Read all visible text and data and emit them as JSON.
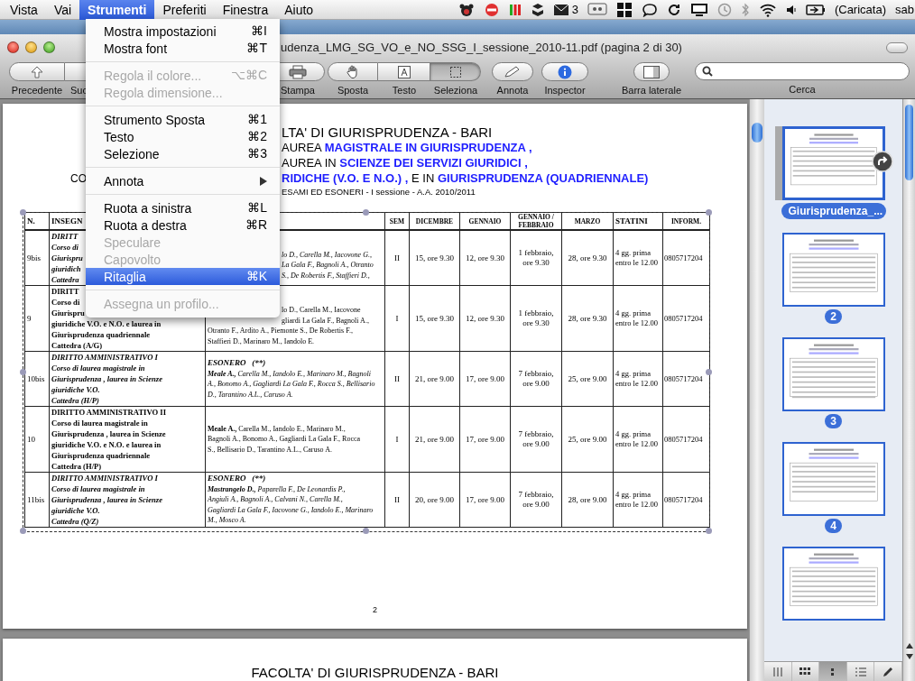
{
  "menubar": {
    "items": [
      {
        "label": "Vista",
        "selected": false
      },
      {
        "label": "Vai",
        "selected": false
      },
      {
        "label": "Strumenti",
        "selected": true
      },
      {
        "label": "Preferiti",
        "selected": false
      },
      {
        "label": "Finestra",
        "selected": false
      },
      {
        "label": "Aiuto",
        "selected": false
      }
    ],
    "mail_count": "3",
    "battery": "(Caricata)",
    "user": "sab"
  },
  "menu": {
    "items": [
      {
        "kind": "item",
        "label": "Mostra impostazioni",
        "shortcut": "⌘I",
        "disabled": false,
        "selected": false
      },
      {
        "kind": "item",
        "label": "Mostra font",
        "shortcut": "⌘T",
        "disabled": false,
        "selected": false
      },
      {
        "kind": "separator"
      },
      {
        "kind": "item",
        "label": "Regola il colore...",
        "shortcut": "⌥⌘C",
        "disabled": true,
        "selected": false
      },
      {
        "kind": "item",
        "label": "Regola dimensione...",
        "disabled": true,
        "selected": false
      },
      {
        "kind": "separator"
      },
      {
        "kind": "item",
        "label": "Strumento Sposta",
        "shortcut": "⌘1",
        "disabled": false,
        "selected": false
      },
      {
        "kind": "item",
        "label": "Testo",
        "shortcut": "⌘2",
        "disabled": false,
        "selected": false
      },
      {
        "kind": "item",
        "label": "Selezione",
        "shortcut": "⌘3",
        "disabled": false,
        "selected": false
      },
      {
        "kind": "separator"
      },
      {
        "kind": "submenu",
        "label": "Annota",
        "disabled": false,
        "selected": false
      },
      {
        "kind": "separator"
      },
      {
        "kind": "item",
        "label": "Ruota a sinistra",
        "shortcut": "⌘L",
        "disabled": false,
        "selected": false
      },
      {
        "kind": "item",
        "label": "Ruota a destra",
        "shortcut": "⌘R",
        "disabled": false,
        "selected": false
      },
      {
        "kind": "item",
        "label": "Speculare",
        "disabled": true,
        "selected": false
      },
      {
        "kind": "item",
        "label": "Capovolto",
        "disabled": true,
        "selected": false
      },
      {
        "kind": "item",
        "label": "Ritaglia",
        "shortcut": "⌘K",
        "disabled": false,
        "selected": true
      },
      {
        "kind": "separator"
      },
      {
        "kind": "item",
        "label": "Assegna un profilo...",
        "disabled": true,
        "selected": false
      }
    ]
  },
  "window": {
    "title": "udenza_LMG_SG_VO_e_NO_SSG_I_sessione_2010-11.pdf (pagina 2 di 30)"
  },
  "toolbar": {
    "nav": [
      {
        "label": "Precedente"
      },
      {
        "label": "Suc"
      }
    ],
    "print": {
      "label": "Stampa"
    },
    "tools": [
      {
        "label": "Sposta",
        "selected": false
      },
      {
        "label": "Testo",
        "selected": false
      },
      {
        "label": "Seleziona",
        "selected": true
      }
    ],
    "annotate": {
      "label": "Annota"
    },
    "inspector": {
      "label": "Inspector"
    },
    "sidebar_toggle": {
      "label": "Barra laterale"
    },
    "search": {
      "label": "Cerca"
    }
  },
  "document": {
    "header": [
      {
        "kind": "title",
        "parts": [
          {
            "text": "LTA' DI GIURISPRUDENZA - BARI",
            "highlight": false
          }
        ]
      },
      {
        "kind": "subtitle",
        "parts": [
          {
            "text": "AUREA",
            "highlight": false
          },
          {
            "text": "MAGISTRALE IN GIURISPRUDENZA ,",
            "highlight": true
          }
        ]
      },
      {
        "kind": "subtitle",
        "parts": [
          {
            "text": "AUREA IN",
            "highlight": false
          },
          {
            "text": "SCIENZE DEI SERVIZI GIURIDICI ,",
            "highlight": true
          }
        ]
      },
      {
        "kind": "subtitle",
        "left": "CO",
        "parts": [
          {
            "text": "RIDICHE (V.O. E N.O.) ,",
            "highlight": true
          },
          {
            "text": " E IN",
            "highlight": false
          },
          {
            "text": "GIURISPRUDENZA (QUADRIENNALE)",
            "highlight": true
          }
        ]
      },
      {
        "kind": "note",
        "parts": [
          {
            "text": "ESAMI ED ESONERI - I  sessione - A.A. 2010/2011",
            "highlight": false
          }
        ]
      }
    ],
    "table": {
      "columns": [
        {
          "label": "N."
        },
        {
          "label": "INSEGN"
        },
        {
          "label": "SEM"
        },
        {
          "label": "DICEMBRE"
        },
        {
          "label": "GENNAIO"
        },
        {
          "label": "GENNAIO / FEBBRAIO"
        },
        {
          "label": "MARZO"
        },
        {
          "label": "STATINI"
        },
        {
          "label": "INFORM."
        }
      ],
      "rows": [
        {
          "n": "9bis",
          "course": {
            "italic": true,
            "lines": [
              "DIRITT",
              "Corso di",
              "Giurispru",
              "giuridich",
              "Cattedra"
            ]
          },
          "board": {
            "italic": true,
            "lines": [
              {
                "text": "lo D., Carella M., Iacovone G.,",
                "covered": true
              },
              {
                "text": "La Gala F., Bagnoli A., Otranto",
                "covered": true
              },
              {
                "text": "S., De Robertis F., Staffieri D.,",
                "covered": true
              }
            ]
          },
          "sem": "II",
          "dicembre": "15, ore 9.30",
          "gennaio": "12, ore 9.30",
          "gen_feb": "1 febbraio, ore 9.30",
          "marzo": "28, ore 9.30",
          "statini": "4 gg. prima entro le 12.00",
          "inform": "0805717204"
        },
        {
          "n": "9",
          "course": {
            "italic": false,
            "lines": [
              "DIRITT",
              "Corso di",
              "Giurispru",
              "giuridiche V.O. e N.O. e laurea in",
              "Giurisprudenza quadriennale",
              "Cattedra (A/G)"
            ]
          },
          "board": {
            "italic": false,
            "lines": [
              {
                "text": "lo D., Carella M., Iacovone",
                "covered": true
              },
              {
                "text": "gliardi La Gala F., Bagnoli A.,",
                "covered": true
              },
              {
                "text": "Otranto F., Ardito A., Piemonte S., De Robertis F.,",
                "covered": false
              },
              {
                "text": "Staffieri D., Marinaro M., Iandolo E.",
                "covered": false
              }
            ]
          },
          "sem": "I",
          "dicembre": "15, ore 9.30",
          "gennaio": "12, ore 9.30",
          "gen_feb": "1 febbraio, ore 9.30",
          "marzo": "28, ore 9.30",
          "statini": "4 gg. prima entro le 12.00",
          "inform": "0805717204"
        },
        {
          "n": "10bis",
          "course": {
            "italic": true,
            "lines": [
              "DIRITTO AMMINISTRATIVO I",
              "Corso di laurea magistrale in",
              "Giurisprudenza , laurea in Scienze",
              "giuridiche V.O.",
              "Cattedra (H/P)"
            ]
          },
          "board": {
            "italic": true,
            "heading": "ESONERO   (**)",
            "lines": [
              {
                "text": "**Meale A.,** Carella M., Iandolo E., Marinaro M., Bagnoli",
                "covered": false
              },
              {
                "text": "A., Bonomo A., Gagliardi La Gala F., Rocca S., Bellisario",
                "covered": false
              },
              {
                "text": "D., Tarantino A.L., Caruso A.",
                "covered": false
              }
            ]
          },
          "sem": "II",
          "dicembre": "21, ore 9.00",
          "gennaio": "17, ore 9.00",
          "gen_feb": "7 febbraio, ore 9.00",
          "marzo": "25, ore 9.00",
          "statini": "4 gg. prima entro le 12.00",
          "inform": "0805717204"
        },
        {
          "n": "10",
          "course": {
            "italic": false,
            "lines": [
              "DIRITTO AMMINISTRATIVO II",
              "Corso di laurea magistrale in",
              "Giurisprudenza , laurea in Scienze",
              "giuridiche V.O. e N.O. e laurea in",
              "Giurisprudenza quadriennale",
              "Cattedra (H/P)"
            ]
          },
          "board": {
            "italic": false,
            "lines": [
              {
                "text": "**Meale A.,** Carella M., Iandolo E., Marinaro M.,",
                "covered": false
              },
              {
                "text": "Bagnoli A., Bonomo A., Gagliardi La Gala F., Rocca",
                "covered": false
              },
              {
                "text": "S., Bellisario D., Tarantino A.L., Caruso A.",
                "covered": false
              }
            ]
          },
          "sem": "I",
          "dicembre": "21, ore 9.00",
          "gennaio": "17, ore 9.00",
          "gen_feb": "7 febbraio, ore 9.00",
          "marzo": "25, ore 9.00",
          "statini": "4 gg. prima entro le 12.00",
          "inform": "0805717204"
        },
        {
          "n": "11bis",
          "course": {
            "italic": true,
            "lines": [
              "DIRITTO AMMINISTRATIVO I",
              "Corso di laurea magistrale in",
              "Giurisprudenza , laurea in Scienze",
              "giuridiche V.O.",
              "Cattedra (Q/Z)"
            ]
          },
          "board": {
            "italic": true,
            "heading": "ESONERO   (**)",
            "lines": [
              {
                "text": "**Mastrangelo D.,** Paparella F., De Leonardis P.,",
                "covered": false
              },
              {
                "text": "Angiuli A., Bagnoli A., Calvani N., Carella M.,",
                "covered": false
              },
              {
                "text": "Gagliardi La Gala F., Iacovone G., Iandolo E., Marinaro",
                "covered": false
              },
              {
                "text": "M., Mosco A.",
                "covered": false
              }
            ]
          },
          "sem": "II",
          "dicembre": "20, ore 9.00",
          "gennaio": "17, ore 9.00",
          "gen_feb": "7 febbraio, ore 9.00",
          "marzo": "28, ore 9.00",
          "statini": "4 gg. prima entro le 12.00",
          "inform": "0805717204"
        }
      ]
    },
    "page_number": "2",
    "next_page_title": "FACOLTA' DI GIURISPRUDENZA - BARI"
  },
  "sidebar": {
    "thumbnails": [
      {
        "label": "Giurisprudenza_...",
        "selected": true
      },
      {
        "label": "2",
        "selected": false
      },
      {
        "label": "3",
        "selected": false
      },
      {
        "label": "4",
        "selected": false
      },
      {
        "selected": false
      }
    ],
    "view_buttons": [
      {
        "selected": false
      },
      {
        "selected": false
      },
      {
        "selected": true
      },
      {
        "selected": false
      },
      {
        "selected": false
      }
    ]
  }
}
